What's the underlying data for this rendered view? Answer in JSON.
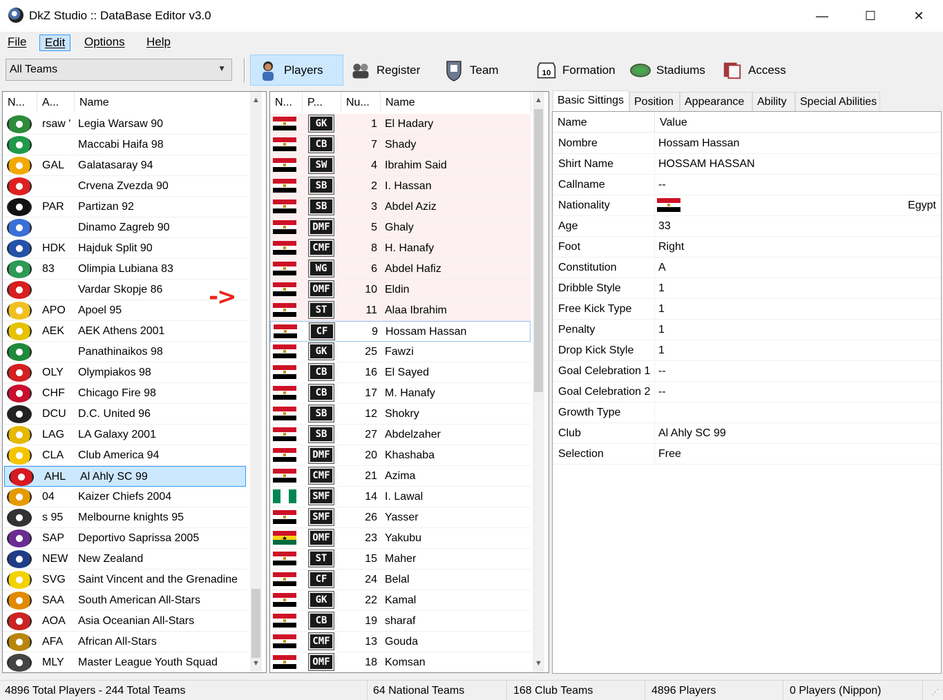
{
  "window": {
    "title": "DkZ Studio :: DataBase Editor v3.0",
    "minimize": "—",
    "maximize": "☐",
    "close": "✕"
  },
  "menu": [
    "File",
    "Edit",
    "Options",
    "Help"
  ],
  "toolbar": {
    "team_filter": "All Teams",
    "buttons": [
      {
        "label": "Players",
        "icon": "player-icon"
      },
      {
        "label": "Register",
        "icon": "register-icon"
      },
      {
        "label": "Team",
        "icon": "team-icon"
      },
      {
        "label": "Formation",
        "icon": "formation-icon"
      },
      {
        "label": "Stadiums",
        "icon": "stadium-icon"
      },
      {
        "label": "Access",
        "icon": "access-icon"
      }
    ]
  },
  "teams": {
    "columns": [
      "N...",
      "A...",
      "Name"
    ],
    "rows": [
      {
        "abbr": "rsaw '",
        "name": "Legia Warsaw 90",
        "color": "#2e8b3a"
      },
      {
        "abbr": "",
        "name": "Maccabi Haifa 98",
        "color": "#1e9a4a"
      },
      {
        "abbr": "GAL",
        "name": "Galatasaray 94",
        "color": "#f2a900"
      },
      {
        "abbr": "",
        "name": "Crvena Zvezda 90",
        "color": "#e02020"
      },
      {
        "abbr": "PAR",
        "name": "Partizan 92",
        "color": "#111111"
      },
      {
        "abbr": "",
        "name": "Dinamo Zagreb 90",
        "color": "#3a6fd8"
      },
      {
        "abbr": "HDK",
        "name": "Hajduk Split 90",
        "color": "#2452a8"
      },
      {
        "abbr": "83",
        "name": "Olimpia Lubiana 83",
        "color": "#2d9a55"
      },
      {
        "abbr": "",
        "name": "Vardar Skopje 86",
        "color": "#d81e1e"
      },
      {
        "abbr": "APO",
        "name": "Apoel 95",
        "color": "#f0c020"
      },
      {
        "abbr": "AEK",
        "name": "AEK Athens 2001",
        "color": "#e6c200"
      },
      {
        "abbr": "",
        "name": "Panathinaikos 98",
        "color": "#1f8a3c"
      },
      {
        "abbr": "OLY",
        "name": "Olympiakos 98",
        "color": "#d42020"
      },
      {
        "abbr": "CHF",
        "name": "Chicago Fire 98",
        "color": "#c8102e"
      },
      {
        "abbr": "DCU",
        "name": "D.C. United 96",
        "color": "#222222"
      },
      {
        "abbr": "LAG",
        "name": "LA Galaxy 2001",
        "color": "#e6b800"
      },
      {
        "abbr": "CLA",
        "name": "Club America 94",
        "color": "#f5c400"
      },
      {
        "abbr": "AHL",
        "name": "Al Ahly SC 99",
        "color": "#d71920"
      },
      {
        "abbr": "04",
        "name": "Kaizer Chiefs 2004",
        "color": "#e59b00"
      },
      {
        "abbr": "s 95",
        "name": "Melbourne knights 95",
        "color": "#333333"
      },
      {
        "abbr": "SAP",
        "name": "Deportivo Saprissa 2005",
        "color": "#6a2c91"
      },
      {
        "abbr": "NEW",
        "name": "New Zealand",
        "color": "#1f3c88"
      },
      {
        "abbr": "SVG",
        "name": "Saint Vincent and the Grenadine",
        "color": "#f2d300"
      },
      {
        "abbr": "SAA",
        "name": "South American All-Stars",
        "color": "#e08a00"
      },
      {
        "abbr": "AOA",
        "name": "Asia Oceanian All-Stars",
        "color": "#cc2222"
      },
      {
        "abbr": "AFA",
        "name": "African All-Stars",
        "color": "#b8860b"
      },
      {
        "abbr": "MLY",
        "name": "Master League Youth Squad",
        "color": "#444444"
      }
    ],
    "selected": 17
  },
  "arrow_text": "->",
  "players": {
    "columns": [
      "N...",
      "P...",
      "Nu...",
      "Name"
    ],
    "rows": [
      {
        "flag": "egypt",
        "pos": "GK",
        "num": "1",
        "name": "El Hadary"
      },
      {
        "flag": "egypt",
        "pos": "CB",
        "num": "7",
        "name": "Shady"
      },
      {
        "flag": "egypt",
        "pos": "SW",
        "num": "4",
        "name": "Ibrahim Said"
      },
      {
        "flag": "egypt",
        "pos": "SB",
        "num": "2",
        "name": "I. Hassan"
      },
      {
        "flag": "egypt",
        "pos": "SB",
        "num": "3",
        "name": "Abdel Aziz"
      },
      {
        "flag": "egypt",
        "pos": "DMF",
        "num": "5",
        "name": "Ghaly"
      },
      {
        "flag": "egypt",
        "pos": "CMF",
        "num": "8",
        "name": "H. Hanafy"
      },
      {
        "flag": "egypt",
        "pos": "WG",
        "num": "6",
        "name": "Abdel Hafiz"
      },
      {
        "flag": "egypt",
        "pos": "OMF",
        "num": "10",
        "name": "Eldin"
      },
      {
        "flag": "egypt",
        "pos": "ST",
        "num": "11",
        "name": "Alaa Ibrahim"
      },
      {
        "flag": "egypt",
        "pos": "CF",
        "num": "9",
        "name": "Hossam Hassan"
      },
      {
        "flag": "egypt",
        "pos": "GK",
        "num": "25",
        "name": "Fawzi"
      },
      {
        "flag": "egypt",
        "pos": "CB",
        "num": "16",
        "name": "El Sayed"
      },
      {
        "flag": "egypt",
        "pos": "CB",
        "num": "17",
        "name": "M. Hanafy"
      },
      {
        "flag": "egypt",
        "pos": "SB",
        "num": "12",
        "name": "Shokry"
      },
      {
        "flag": "egypt",
        "pos": "SB",
        "num": "27",
        "name": "Abdelzaher"
      },
      {
        "flag": "egypt",
        "pos": "DMF",
        "num": "20",
        "name": "Khashaba"
      },
      {
        "flag": "egypt",
        "pos": "CMF",
        "num": "21",
        "name": "Azima"
      },
      {
        "flag": "nigeria",
        "pos": "SMF",
        "num": "14",
        "name": "I. Lawal"
      },
      {
        "flag": "egypt",
        "pos": "SMF",
        "num": "26",
        "name": "Yasser"
      },
      {
        "flag": "ghana",
        "pos": "OMF",
        "num": "23",
        "name": "Yakubu"
      },
      {
        "flag": "egypt",
        "pos": "ST",
        "num": "15",
        "name": "Maher"
      },
      {
        "flag": "egypt",
        "pos": "CF",
        "num": "24",
        "name": "Belal"
      },
      {
        "flag": "egypt",
        "pos": "GK",
        "num": "22",
        "name": "Kamal"
      },
      {
        "flag": "egypt",
        "pos": "CB",
        "num": "19",
        "name": "sharaf"
      },
      {
        "flag": "egypt",
        "pos": "CMF",
        "num": "13",
        "name": "Gouda"
      },
      {
        "flag": "egypt",
        "pos": "OMF",
        "num": "18",
        "name": "Komsan"
      }
    ],
    "highlighted_count": 10,
    "selected": 10
  },
  "tabs": [
    "Basic Sittings",
    "Position",
    "Appearance",
    "Ability",
    "Special Abilities"
  ],
  "props": {
    "columns": [
      "Name",
      "Value"
    ],
    "rows": [
      {
        "name": "Nombre",
        "value": "Hossam Hassan"
      },
      {
        "name": "Shirt Name",
        "value": "HOSSAM HASSAN"
      },
      {
        "name": "Callname",
        "value": "--"
      },
      {
        "name": "Nationality",
        "value": "Egypt",
        "flag": "egypt"
      },
      {
        "name": "Age",
        "value": "33"
      },
      {
        "name": "Foot",
        "value": "Right"
      },
      {
        "name": "Constitution",
        "value": "A"
      },
      {
        "name": "Dribble Style",
        "value": "1"
      },
      {
        "name": "Free Kick Type",
        "value": "1"
      },
      {
        "name": "Penalty",
        "value": "1"
      },
      {
        "name": "Drop Kick Style",
        "value": "1"
      },
      {
        "name": "Goal Celebration 1",
        "value": "--"
      },
      {
        "name": "Goal Celebration 2",
        "value": "--"
      },
      {
        "name": "Growth Type",
        "value": ""
      },
      {
        "name": "Club",
        "value": "Al Ahly SC 99"
      },
      {
        "name": "Selection",
        "value": "Free"
      }
    ]
  },
  "status": [
    "4896 Total Players  -  244 Total Teams",
    "64 National Teams",
    "168 Club Teams",
    "4896 Players",
    "0 Players (Nippon)"
  ],
  "colors": {
    "highlight_row": "#fdf0f0",
    "selected_row": "#cce8ff",
    "selected_border": "#3399ff",
    "egypt_red": "#ce1126",
    "egypt_black": "#000000"
  }
}
